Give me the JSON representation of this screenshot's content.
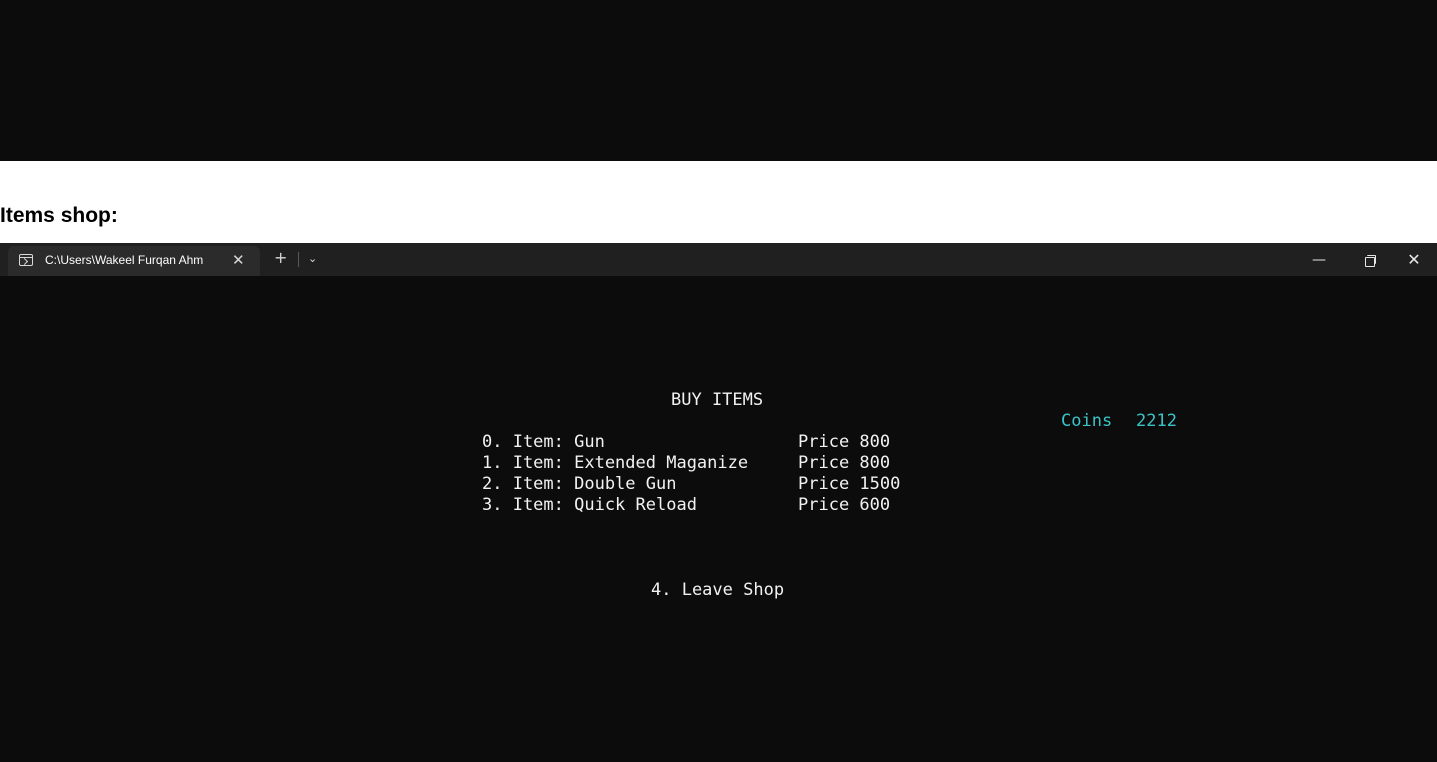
{
  "document": {
    "heading": "Items shop:"
  },
  "window": {
    "tab_title": "C:\\Users\\Wakeel Furqan Ahm",
    "tab_close": "✕",
    "new_tab": "+",
    "dropdown": "⌄",
    "minimize": "—",
    "close": "✕",
    "icons": {
      "tab": "terminal-icon",
      "tab_close": "close-icon",
      "new_tab": "plus-icon",
      "dropdown": "chevron-down-icon",
      "minimize": "minimize-icon",
      "maximize": "restore-icon",
      "close": "close-icon"
    }
  },
  "terminal": {
    "menu_title": "BUY ITEMS",
    "coins_label": "Coins",
    "coins_value": "2212",
    "items": [
      {
        "label": "0. Item: Gun",
        "price": "Price 800"
      },
      {
        "label": "1. Item: Extended Maganize",
        "price": "Price 800"
      },
      {
        "label": "2. Item: Double Gun",
        "price": "Price 1500"
      },
      {
        "label": "3. Item: Quick Reload",
        "price": "Price 600"
      }
    ],
    "leave_option": "4. Leave Shop",
    "colors": {
      "background": "#0c0c0c",
      "text": "#f2f2f2",
      "coins": "#3ac4c8"
    }
  }
}
